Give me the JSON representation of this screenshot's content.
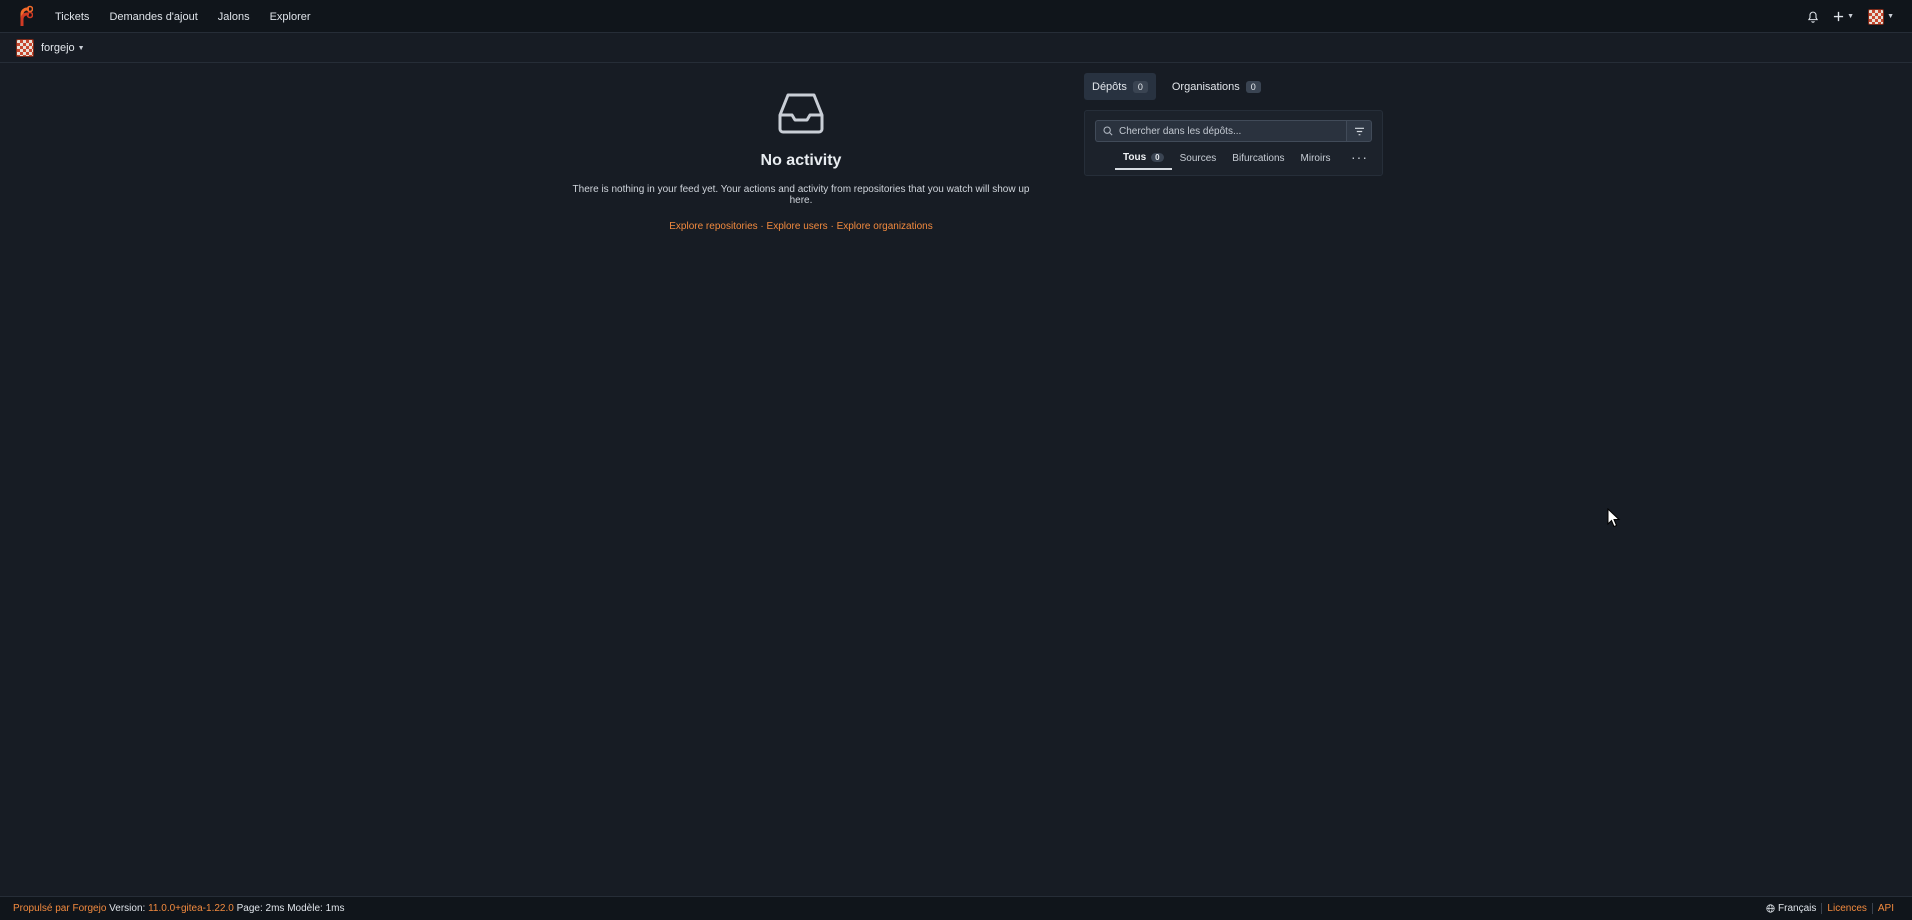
{
  "nav": {
    "items": [
      "Tickets",
      "Demandes d'ajout",
      "Jalons",
      "Explorer"
    ]
  },
  "context": {
    "user": "forgejo"
  },
  "feed": {
    "title": "No activity",
    "message": "There is nothing in your feed yet. Your actions and activity from repositories that you watch will show up here.",
    "links": [
      "Explore repositories",
      "Explore users",
      "Explore organizations"
    ],
    "separator": "·"
  },
  "sidebar": {
    "tabs": [
      {
        "label": "Dépôts",
        "count": "0"
      },
      {
        "label": "Organisations",
        "count": "0"
      }
    ],
    "search_placeholder": "Chercher dans les dépôts...",
    "subtabs": [
      {
        "label": "Tous",
        "count": "0"
      },
      {
        "label": "Sources"
      },
      {
        "label": "Bifurcations"
      },
      {
        "label": "Miroirs"
      }
    ]
  },
  "footer": {
    "powered": "Propulsé par Forgejo",
    "version_label": "Version:",
    "version": "11.0.0+gitea-1.22.0",
    "page_label": "Page:",
    "page_time": "2ms",
    "template_label": "Modèle:",
    "template_time": "1ms",
    "language": "Français",
    "licenses": "Licences",
    "api": "API"
  },
  "colors": {
    "accent": "#f28a3e",
    "background": "#171c24",
    "topbar": "#10151b"
  }
}
